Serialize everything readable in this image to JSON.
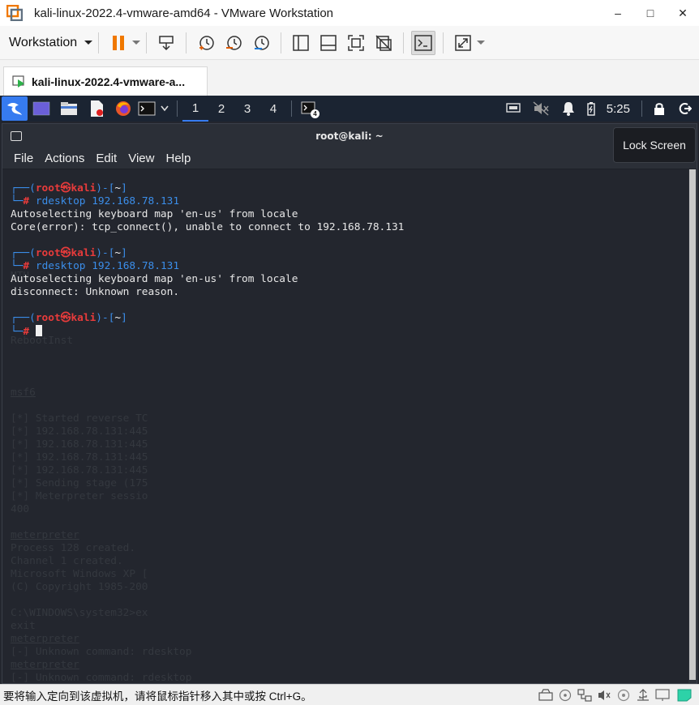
{
  "window": {
    "title": "kali-linux-2022.4-vmware-amd64 - VMware Workstation",
    "minimize": "–",
    "maximize": "□",
    "close": "✕"
  },
  "toolbar": {
    "workstation_label": "Workstation"
  },
  "tab": {
    "label": "kali-linux-2022.4-vmware-a..."
  },
  "panel": {
    "workspaces": [
      "1",
      "2",
      "3",
      "4"
    ],
    "clock": "5:25",
    "terminal_badge": "4"
  },
  "terminal": {
    "title": "root@kali: ~",
    "menu": [
      "File",
      "Actions",
      "Edit",
      "View",
      "Help"
    ],
    "prompt_user": "root",
    "prompt_at": "㉿",
    "prompt_host": "kali",
    "prompt_dir": "~",
    "lines": {
      "cmd1": "rdesktop 192.168.78.131",
      "out1a": "Autoselecting keyboard map 'en-us' from locale",
      "out1b": "Core(error): tcp_connect(), unable to connect to 192.168.78.131",
      "cmd2": "rdesktop 192.168.78.131",
      "out2a": "Autoselecting keyboard map 'en-us' from locale",
      "out2b": "disconnect: Unknown reason."
    }
  },
  "tooltip": {
    "text": "Lock Screen"
  },
  "statusbar": {
    "message": "要将输入定向到该虚拟机，请将鼠标指针移入其中或按 Ctrl+G。"
  },
  "colors": {
    "kali_blue": "#367bf0",
    "prompt_blue": "#3b8eea",
    "prompt_red": "#e83b3b",
    "vmware_orange": "#f07800"
  }
}
